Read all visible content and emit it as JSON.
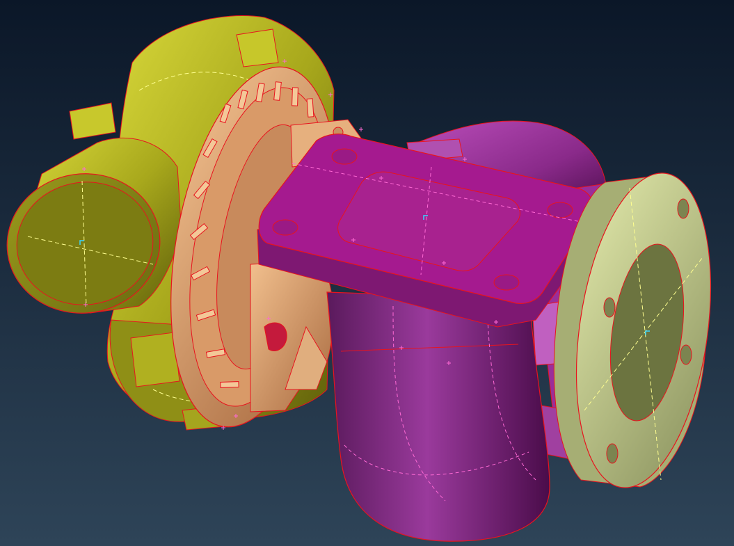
{
  "viewport": {
    "background_colors": {
      "top": "#0b1728",
      "bottom": "#2e4458"
    }
  },
  "model": {
    "parts": [
      {
        "id": "compressor-housing",
        "color": "#b4b41e"
      },
      {
        "id": "center-housing",
        "color": "#d4a070"
      },
      {
        "id": "turbine-housing",
        "color": "#8a2a8a"
      },
      {
        "id": "turbine-inlet-flange",
        "color": "#a51a8f"
      },
      {
        "id": "outlet-flange",
        "color": "#c8d490"
      }
    ],
    "overlay_colors": {
      "edges": "#e8141e",
      "construction_lines": "#ffff90",
      "vertex_markers": "#ff6ad5",
      "axis_markers": "#38d6ff"
    }
  }
}
